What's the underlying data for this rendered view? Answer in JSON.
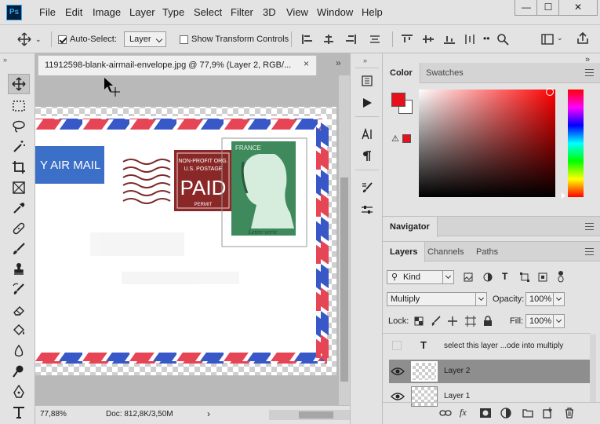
{
  "app": {
    "logo": "Ps"
  },
  "menu": [
    "File",
    "Edit",
    "Image",
    "Layer",
    "Type",
    "Select",
    "Filter",
    "3D",
    "View",
    "Window",
    "Help"
  ],
  "window_controls": {
    "minimize": "—",
    "maximize": "☐",
    "close": "✕"
  },
  "options": {
    "auto_select_label": "Auto-Select:",
    "auto_select_checked": true,
    "auto_select_target": "Layer",
    "transform_controls_label": "Show Transform Controls"
  },
  "document": {
    "tab_title": "11912598-blank-airmail-envelope.jpg @ 77,9% (Layer 2, RGB/...",
    "close_glyph": "×",
    "collapse_glyph": "»",
    "status": {
      "zoom": "77,88%",
      "doc_size": "Doc: 812,8K/3,50M",
      "arrow": "›"
    },
    "artwork": {
      "airmail_label": "Y AIR MAIL",
      "postage_line1": "NON-PROFIT ORG.",
      "postage_line2": "U.S. POSTAGE",
      "postage_paid": "PAID",
      "postage_permit": "PERMIT",
      "stamp_country": "FRANCE",
      "stamp_caption": "Lettre verte"
    }
  },
  "color_panel": {
    "tabs": [
      "Color",
      "Swatches"
    ],
    "foreground": "#e8101a",
    "background": "#ffffff",
    "gamut_color": "#e8101a"
  },
  "navigator_panel": {
    "title": "Navigator"
  },
  "layers_panel": {
    "tabs": [
      "Layers",
      "Channels",
      "Paths"
    ],
    "filter": "Kind",
    "blend_mode": "Multiply",
    "opacity_label": "Opacity:",
    "opacity_value": "100%",
    "lock_label": "Lock:",
    "fill_label": "Fill:",
    "fill_value": "100%",
    "layers": [
      {
        "name": "select this layer ...ode  into multiply",
        "type": "text",
        "visible": false,
        "selected": false
      },
      {
        "name": "Layer 2",
        "type": "pixel",
        "visible": true,
        "selected": true
      },
      {
        "name": "Layer 1",
        "type": "pixel",
        "visible": true,
        "selected": false
      }
    ]
  },
  "colors": {
    "selected_layer": "#8e8e8e",
    "panel_bg": "#e3e3e3",
    "canvas_bg": "#b9b9b9"
  }
}
